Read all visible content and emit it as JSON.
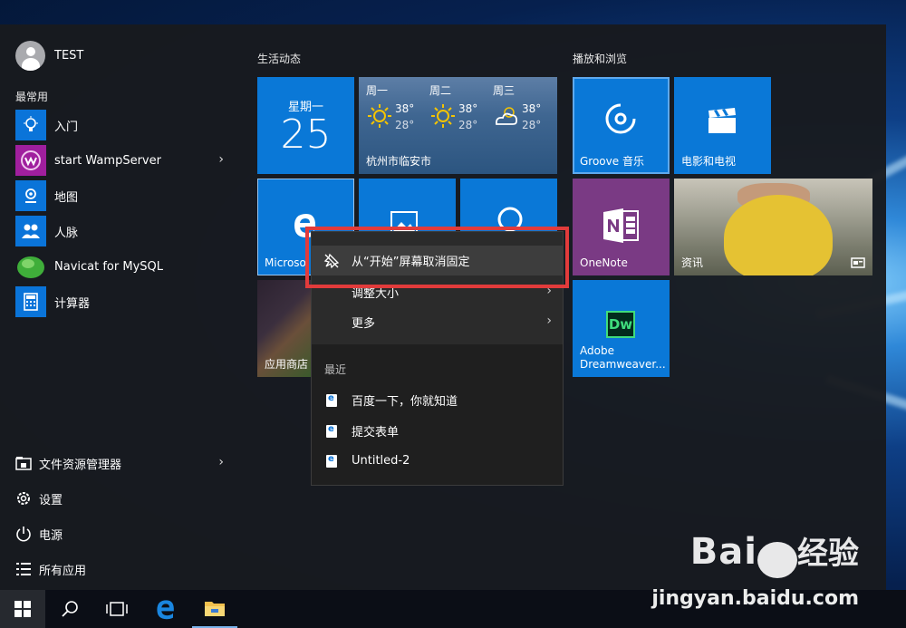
{
  "user": {
    "name": "TEST"
  },
  "most_used": {
    "label": "最常用",
    "apps": [
      {
        "label": "入门",
        "icon": "lightbulb-icon"
      },
      {
        "label": "start WampServer",
        "icon": "wampserver-icon",
        "chevron": "›"
      },
      {
        "label": "地图",
        "icon": "map-icon"
      },
      {
        "label": "人脉",
        "icon": "people-icon"
      },
      {
        "label": "Navicat for MySQL",
        "icon": "navicat-icon"
      },
      {
        "label": "计算器",
        "icon": "calculator-icon"
      }
    ]
  },
  "system": [
    {
      "label": "文件资源管理器",
      "icon": "folder-icon",
      "chevron": "›"
    },
    {
      "label": "设置",
      "icon": "gear-icon"
    },
    {
      "label": "电源",
      "icon": "power-icon"
    },
    {
      "label": "所有应用",
      "icon": "list-icon"
    }
  ],
  "groups": {
    "live": "生活动态",
    "play": "播放和浏览"
  },
  "tiles": {
    "calendar": {
      "day": "星期一",
      "date": "25"
    },
    "weather": {
      "days": [
        {
          "name": "周一",
          "hi": "38°",
          "lo": "28°",
          "icon": "sun-icon"
        },
        {
          "name": "周二",
          "hi": "38°",
          "lo": "28°",
          "icon": "sun-icon"
        },
        {
          "name": "周三",
          "hi": "38°",
          "lo": "28°",
          "icon": "cloud-icon"
        }
      ],
      "city": "杭州市临安市"
    },
    "edge": "Microsoft Edge",
    "edge_visible": "Microso",
    "store": "应用商店",
    "groove": "Groove 音乐",
    "movies": "电影和电视",
    "onenote": "OneNote",
    "news": "资讯",
    "dreamweaver": "Adobe Dreamweaver...",
    "dreamweaver_line1": "Adobe",
    "dreamweaver_line2": "Dreamweaver...",
    "dw_logo": "Dw"
  },
  "context_menu": {
    "unpin": "从“开始”屏幕取消固定",
    "resize": "调整大小",
    "more": "更多",
    "recent_label": "最近",
    "recent": [
      "百度一下，你就知道",
      "提交表单",
      "Untitled-2"
    ]
  },
  "watermark": {
    "brand": "Bai",
    "brand_suffix": "经验",
    "url": "jingyan.baidu.com"
  },
  "colors": {
    "accent": "#0a78d7",
    "onenote": "#7a3a84",
    "highlight": "#e23b3b"
  }
}
